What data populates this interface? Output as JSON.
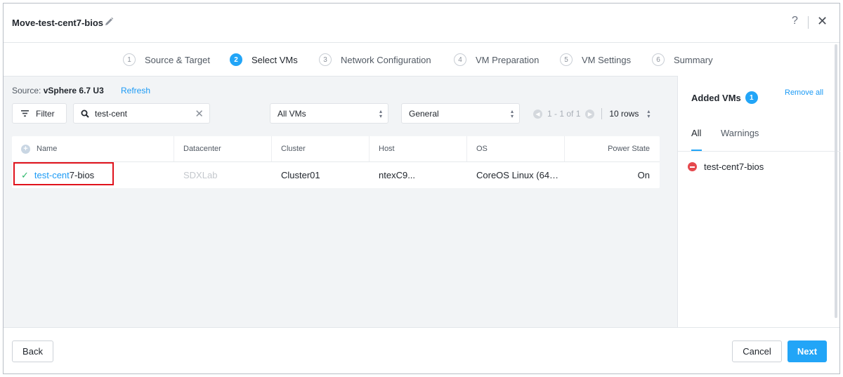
{
  "dialog": {
    "title": "Move-test-cent7-bios",
    "help": "?",
    "close": "✕"
  },
  "steps": [
    {
      "num": "1",
      "label": "Source & Target"
    },
    {
      "num": "2",
      "label": "Select VMs"
    },
    {
      "num": "3",
      "label": "Network Configuration"
    },
    {
      "num": "4",
      "label": "VM Preparation"
    },
    {
      "num": "5",
      "label": "VM Settings"
    },
    {
      "num": "6",
      "label": "Summary"
    }
  ],
  "source": {
    "prefix": "Source:",
    "value": "vSphere 6.7 U3",
    "refresh": "Refresh"
  },
  "toolbar": {
    "filter": "Filter",
    "search_value": "test-cent",
    "vm_select": "All VMs",
    "view_select": "General",
    "pager_range": "1 - 1 of 1",
    "rows": "10 rows"
  },
  "table": {
    "headers": [
      "Name",
      "Datacenter",
      "Cluster",
      "Host",
      "OS",
      "Power State"
    ],
    "rows": [
      {
        "name_match": "test-cent",
        "name_rest": "7-bios",
        "datacenter": "SDXLab",
        "cluster": "Cluster01",
        "host": "ntexC9...",
        "os": "CoreOS Linux (64…",
        "power": "On"
      }
    ]
  },
  "right": {
    "title": "Added VMs",
    "count": "1",
    "remove_all": "Remove all",
    "tabs": [
      "All",
      "Warnings"
    ],
    "items": [
      "test-cent7-bios"
    ]
  },
  "footer": {
    "back": "Back",
    "cancel": "Cancel",
    "next": "Next"
  },
  "colors": {
    "accent": "#22a5f7",
    "success": "#2cb86b",
    "danger": "#e5484d",
    "highlight_box": "#e0121c"
  }
}
